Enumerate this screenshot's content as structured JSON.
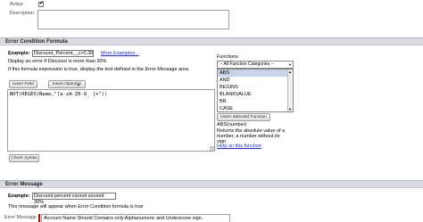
{
  "rule_info": {
    "active_label": "Active",
    "active_checked": true,
    "description_label": "Description"
  },
  "error_condition": {
    "header": "Error Condition Formula",
    "example_label": "Example:",
    "example_value": "Discount_Percent__c>0.30",
    "more_examples": "More Examples...",
    "display_text": "Display an error if Discount is more than 30%",
    "instructions": "If this formula expression is true, display the text defined in the Error Message area",
    "insert_field": "Insert Field",
    "insert_operator": "Insert Operator",
    "formula": "NOT(REGEX(Name,\"[a-zA-Z0-9_ ]+\"))",
    "check_syntax": "Check Syntax"
  },
  "functions": {
    "label": "Functions",
    "category": "-- All Function Categories --",
    "items": [
      "ABS",
      "AND",
      "BEGINS",
      "BLANKVALUE",
      "BR",
      "CASE"
    ],
    "selected_index": 0,
    "insert_selected": "Insert Selected Function",
    "signature": "ABS(number)",
    "description": "Returns the absolute value of a number, a number without its sign",
    "help": "Help on this function"
  },
  "error_message": {
    "header": "Error Message",
    "example_label": "Example:",
    "example_value": "Discount percent cannot exceed 30%",
    "note": "This message will appear when Error Condition formula is true",
    "field_label": "Error Message",
    "value": "Account Name Should Contains only Alphanumeric and Underscore sign."
  },
  "colors": {
    "section_header": "#d8dce2",
    "link": "#1a3dad",
    "required_bar": "#c00000"
  }
}
